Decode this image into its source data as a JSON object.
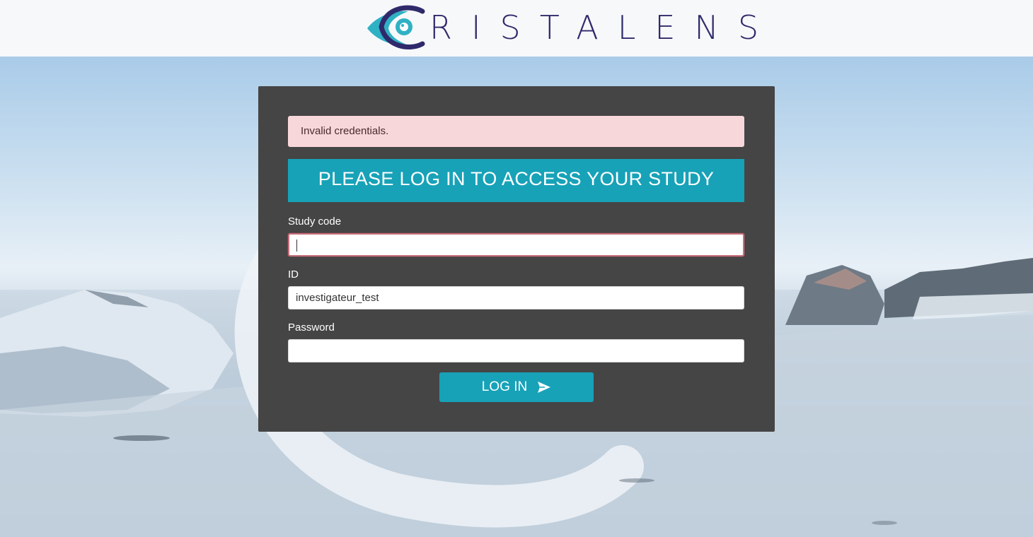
{
  "header": {
    "brand_name": "RISTALENS",
    "logo_colors": {
      "dark": "#2f2a6b",
      "accent": "#2fb1c4"
    }
  },
  "form": {
    "alert_text": "Invalid credentials.",
    "banner_text": "PLEASE LOG IN TO ACCESS YOUR STUDY",
    "study_code": {
      "label": "Study code",
      "value": ""
    },
    "id": {
      "label": "ID",
      "value": "investigateur_test"
    },
    "password": {
      "label": "Password",
      "value": ""
    },
    "submit_label": "LOG IN",
    "submit_icon": "send-icon"
  },
  "colors": {
    "accent": "#17a2b8",
    "panel": "#454545",
    "alert_bg": "#f8d7da"
  }
}
